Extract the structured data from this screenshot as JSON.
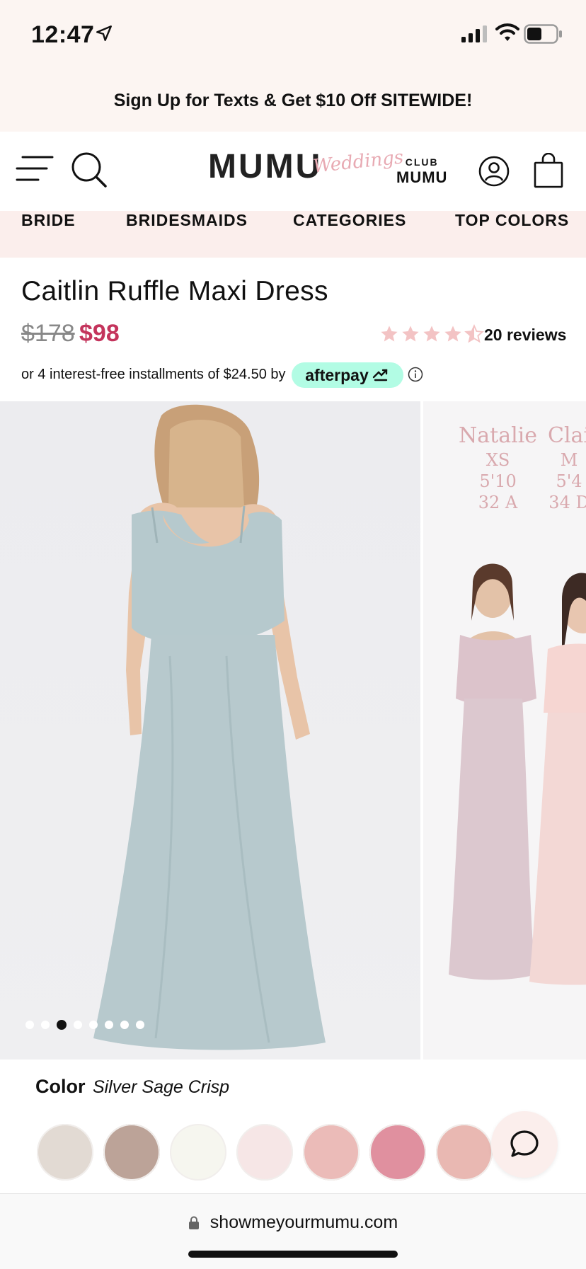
{
  "status": {
    "time": "12:47"
  },
  "promo": {
    "text": "Sign Up for Texts & Get $10 Off SITEWIDE!"
  },
  "header": {
    "logo_main": "MUMU",
    "logo_script": "Weddings",
    "club_small": "CLUB",
    "club_big": "MUMU"
  },
  "nav": {
    "items": [
      "BRIDE",
      "BRIDESMAIDS",
      "CATEGORIES",
      "TOP COLORS"
    ]
  },
  "product": {
    "title": "Caitlin Ruffle Maxi Dress",
    "old_price": "$178",
    "price": "$98",
    "rating": 4.5,
    "reviews": "20 reviews",
    "installments": "or 4 interest-free installments of $24.50 by",
    "afterpay_label": "afterpay"
  },
  "gallery": {
    "image_count": 8,
    "active_index": 2,
    "models": [
      {
        "name": "Natalie",
        "size": "XS",
        "height": "5'10",
        "bra": "32 A"
      },
      {
        "name": "Clai",
        "size": "M",
        "height": "5'4",
        "bra": "34 D"
      }
    ]
  },
  "color": {
    "label": "Color",
    "selected": "Silver Sage Crisp",
    "swatches": [
      "#e2dad3",
      "#bca398",
      "#f6f6ef",
      "#f6e6e6",
      "#ebbbb8",
      "#e0909f",
      "#e9b8b2"
    ]
  },
  "browser": {
    "url": "showmeyourmumu.com"
  },
  "colors": {
    "accent": "#c4345c",
    "star": "#f3c3c4",
    "promo_bg": "#fcf5f2",
    "nav_bg": "#fbeeec",
    "afterpay": "#b2fce4"
  }
}
